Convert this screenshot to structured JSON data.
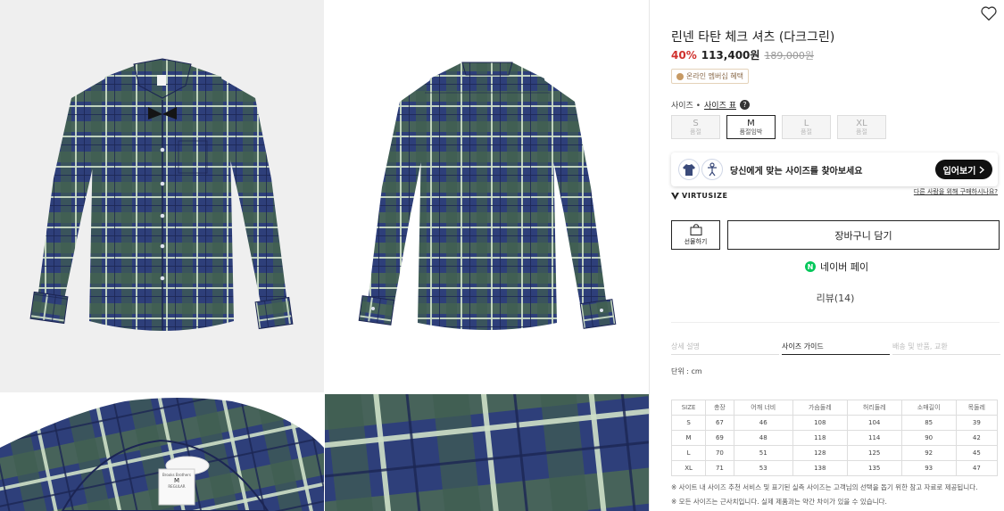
{
  "product": {
    "title": "린넨 타탄 체크 셔츠 (다크그린)",
    "discount": "40%",
    "sale_price": "113,400원",
    "original_price": "189,000원",
    "member_badge": "온라인 멤버십 혜택"
  },
  "size_section": {
    "label": "사이즈 •",
    "guide_link": "사이즈 표",
    "help": "?",
    "options": [
      {
        "name": "S",
        "stock": "품절"
      },
      {
        "name": "M",
        "stock": "품절임박"
      },
      {
        "name": "L",
        "stock": "품절"
      },
      {
        "name": "XL",
        "stock": "품절"
      }
    ],
    "selected": "M"
  },
  "virtusize": {
    "prompt": "당신에게 맞는 사이즈를 찾아보세요",
    "button": "입어보기",
    "button_icon": "chevron-right-icon",
    "logo": "VIRTUSIZE",
    "other_person_link": "다른 사람을 위해 구매하시나요?"
  },
  "actions": {
    "gift_label": "선물하기",
    "cart_label": "장바구니 담기",
    "naver_pay_label": "네이버 페이",
    "naver_icon_letter": "N"
  },
  "reviews_label": "리뷰(14)",
  "tabs": [
    {
      "label": "상세 설명",
      "active": false
    },
    {
      "label": "사이즈 가이드",
      "active": true
    },
    {
      "label": "배송 및 반품, 교환",
      "active": false
    }
  ],
  "unit_label": "단위 : cm",
  "size_table": {
    "headers": [
      "SIZE",
      "총장",
      "어깨 너비",
      "가슴둘레",
      "허리둘레",
      "소매길이",
      "목둘레"
    ],
    "rows": [
      [
        "S",
        "67",
        "46",
        "108",
        "104",
        "85",
        "39"
      ],
      [
        "M",
        "69",
        "48",
        "118",
        "114",
        "90",
        "42"
      ],
      [
        "L",
        "70",
        "51",
        "128",
        "125",
        "92",
        "45"
      ],
      [
        "XL",
        "71",
        "53",
        "138",
        "135",
        "93",
        "47"
      ]
    ]
  },
  "notes": [
    "※  사이트 내 사이즈 추천 서비스 및 표기된 실측 사이즈는 고객님의 선택을 돕기 위한 참고 자료로 제공됩니다.",
    "※  모든 사이즈는 근사치입니다. 실제 제품과는 약간 차이가 있을 수 있습니다."
  ],
  "shirt_label": {
    "line1": "Brooks Brothers",
    "size": "M",
    "line3": "REGULAR"
  },
  "colors": {
    "plaid_navy": "#2e3f7a",
    "plaid_green": "#4b6a55",
    "plaid_light": "#cfe0c8",
    "accent_red": "#d0312d",
    "naver_green": "#03c75a"
  },
  "icons": {
    "wishlist": "heart-icon",
    "gift": "gift-bag-icon",
    "naver": "naver-n-icon"
  }
}
